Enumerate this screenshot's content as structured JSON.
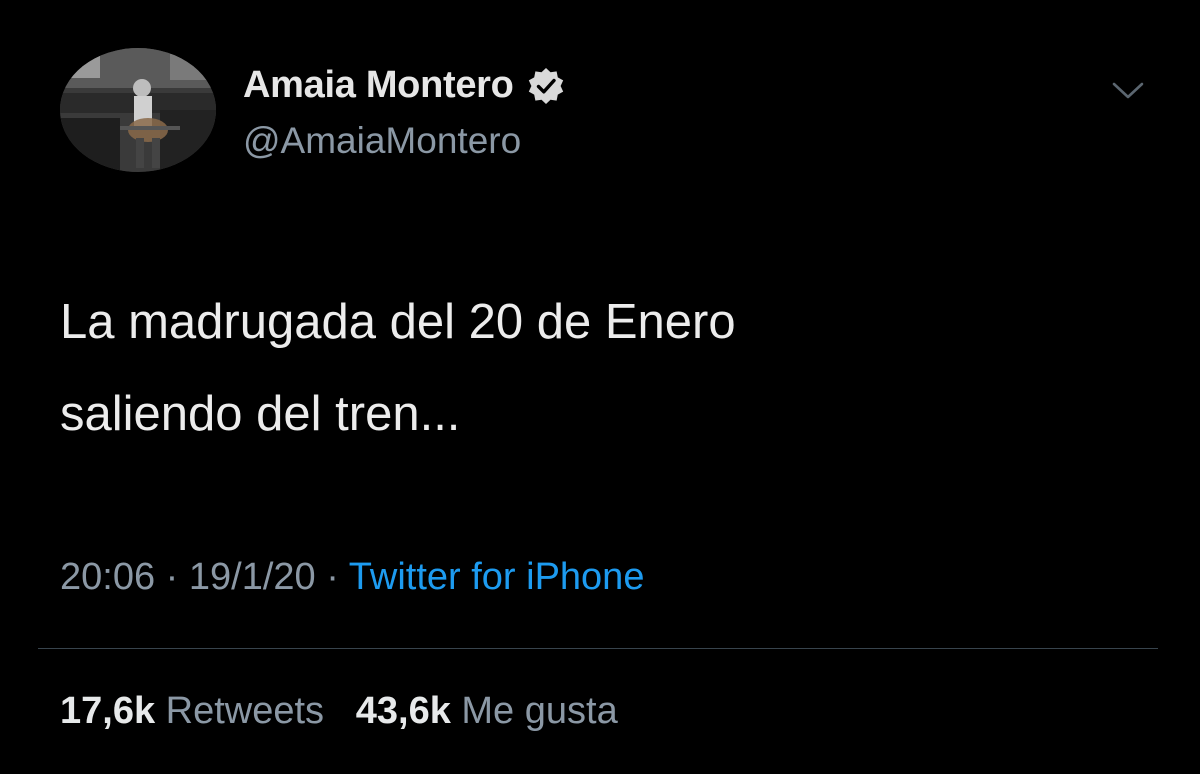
{
  "tweet": {
    "display_name": "Amaia Montero",
    "handle": "@AmaiaMontero",
    "text_lines": [
      "La madrugada del 20 de Enero",
      "saliendo del tren..."
    ],
    "time": "20:06",
    "date": "19/1/20",
    "separator": "·",
    "source": "Twitter for iPhone",
    "retweets_count": "17,6k",
    "retweets_label": "Retweets",
    "likes_count": "43,6k",
    "likes_label": "Me gusta",
    "verified": true
  },
  "icons": {
    "verified": "verified-badge-icon",
    "menu": "chevron-down-icon"
  },
  "colors": {
    "background": "#000000",
    "primary_text": "#e7e9ea",
    "secondary_text": "#8b98a5",
    "link": "#1d9bf0",
    "divider": "#38444d"
  }
}
